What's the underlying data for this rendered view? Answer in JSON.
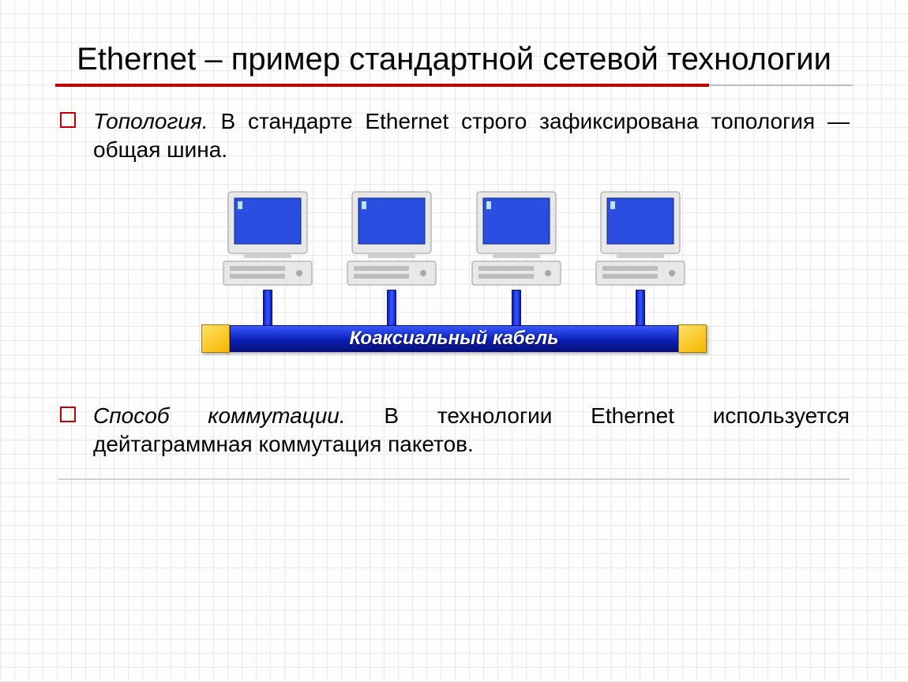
{
  "title": "Ethernet – пример стандартной сетевой технологии",
  "bullets": [
    {
      "lead": "Топология.",
      "text": " В стандарте Ethernet строго зафиксирована топология — общая шина."
    },
    {
      "lead": "Способ коммутации.",
      "text": " В технологии Ethernet используется дейтаграммная коммутация пакетов."
    }
  ],
  "diagram": {
    "cable_label": "Коаксиальный кабель"
  }
}
